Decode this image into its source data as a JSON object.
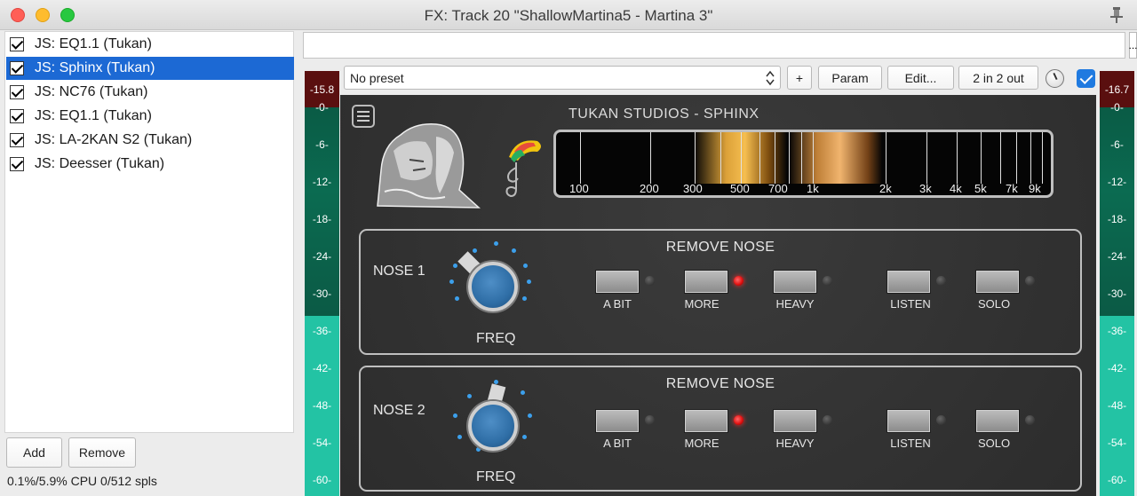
{
  "window": {
    "title": "FX: Track 20 \"ShallowMartina5 - Martina 3\""
  },
  "fx_list": [
    {
      "label": "JS: EQ1.1 (Tukan)",
      "checked": true,
      "selected": false
    },
    {
      "label": "JS: Sphinx (Tukan)",
      "checked": true,
      "selected": true
    },
    {
      "label": "JS: NC76 (Tukan)",
      "checked": true,
      "selected": false
    },
    {
      "label": "JS: EQ1.1 (Tukan)",
      "checked": true,
      "selected": false
    },
    {
      "label": "JS: LA-2KAN S2 (Tukan)",
      "checked": true,
      "selected": false
    },
    {
      "label": "JS: Deesser (Tukan)",
      "checked": true,
      "selected": false
    }
  ],
  "buttons": {
    "add": "Add",
    "remove": "Remove",
    "ellipsis": "...",
    "plus": "+",
    "param": "Param",
    "edit": "Edit...",
    "io": "2 in 2 out"
  },
  "status": "0.1%/5.9% CPU 0/512 spls",
  "preset": {
    "value": "No preset"
  },
  "meters": {
    "left_peak": "-15.8",
    "right_peak": "-16.7",
    "ticks": [
      "-0-",
      "-6-",
      "-12-",
      "-18-",
      "-24-",
      "-30-",
      "-36-",
      "-42-",
      "-48-",
      "-54-",
      "-60-"
    ]
  },
  "plugin": {
    "brand": "TUKAN STUDIOS  -  SPHINX",
    "freq_labels": [
      "100",
      "200",
      "300",
      "500",
      "700",
      "1k",
      "2k",
      "3k",
      "4k",
      "5k",
      "7k",
      "9k"
    ],
    "panels": [
      {
        "name": "NOSE 1",
        "header": "REMOVE NOSE",
        "knob_label": "FREQ",
        "buttons": [
          "A BIT",
          "MORE",
          "HEAVY",
          "LISTEN",
          "SOLO"
        ],
        "active": "MORE"
      },
      {
        "name": "NOSE 2",
        "header": "REMOVE NOSE",
        "knob_label": "FREQ",
        "buttons": [
          "A BIT",
          "MORE",
          "HEAVY",
          "LISTEN",
          "SOLO"
        ],
        "active": "MORE"
      }
    ]
  },
  "colors": {
    "selection": "#1c69d4",
    "meter_peak": "#5a0f0f",
    "meter_dark": "#0b6b51",
    "meter_light": "#23c3a4",
    "led_on": "#e41212",
    "knob_blue": "#2f6ea6"
  },
  "icons": [
    "close-icon",
    "minimize-icon",
    "maximize-icon",
    "pin-icon",
    "checkbox-icon",
    "menu-icon",
    "sphinx-logo",
    "toucan-note-logo",
    "dropdown-arrows-icon",
    "wet-knob-icon",
    "bypass-checkbox-icon"
  ]
}
